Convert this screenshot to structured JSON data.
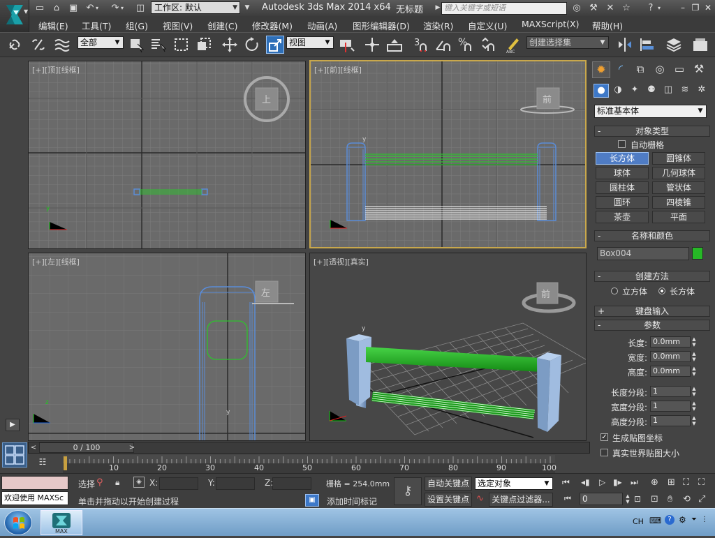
{
  "titlebar": {
    "workspace_label": "工作区: 默认",
    "app_title": "Autodesk 3ds Max  2014 x64",
    "file_title": "无标题",
    "search_placeholder": "键入关键字或短语"
  },
  "menubar": {
    "items": [
      "编辑(E)",
      "工具(T)",
      "组(G)",
      "视图(V)",
      "创建(C)",
      "修改器(M)",
      "动画(A)",
      "图形编辑器(D)",
      "渲染(R)",
      "自定义(U)",
      "MAXScript(X)",
      "帮助(H)"
    ]
  },
  "toolbar": {
    "selection_filter": "全部",
    "reference_coord": "视图",
    "named_selection_placeholder": "创建选择集"
  },
  "viewports": {
    "top": {
      "label": "[+][顶][线框]",
      "cube_label": "上"
    },
    "front": {
      "label": "[+][前][线框]",
      "cube_label": "前"
    },
    "left": {
      "label": "[+][左][线框]",
      "cube_label": "左"
    },
    "perspective": {
      "label": "[+][透视][真实]",
      "cube_label": "前"
    }
  },
  "command_panel": {
    "category": "标准基本体",
    "object_type": {
      "title": "对象类型",
      "autogrid": "自动栅格",
      "buttons": [
        "长方体",
        "圆锥体",
        "球体",
        "几何球体",
        "圆柱体",
        "管状体",
        "圆环",
        "四棱锥",
        "茶壶",
        "平面"
      ],
      "active": "长方体"
    },
    "name_color": {
      "title": "名称和颜色",
      "name": "Box004",
      "color": "#26b826"
    },
    "creation_method": {
      "title": "创建方法",
      "option_cube": "立方体",
      "option_box": "长方体",
      "selected": "长方体"
    },
    "keyboard_entry": {
      "title": "键盘输入"
    },
    "parameters": {
      "title": "参数",
      "length_label": "长度:",
      "length": "0.0mm",
      "width_label": "宽度:",
      "width": "0.0mm",
      "height_label": "高度:",
      "height": "0.0mm",
      "length_segs_label": "长度分段:",
      "length_segs": "1",
      "width_segs_label": "宽度分段:",
      "width_segs": "1",
      "height_segs_label": "高度分段:",
      "height_segs": "1",
      "gen_mapping": "生成贴图坐标",
      "gen_mapping_checked": true,
      "real_world": "真实世界贴图大小",
      "real_world_checked": false
    }
  },
  "timeline": {
    "frame_display": "0 / 100",
    "ticks": [
      "10",
      "20",
      "30",
      "40",
      "50",
      "60",
      "70",
      "80",
      "90",
      "100"
    ]
  },
  "status": {
    "welcome": "欢迎使用 MAXSc",
    "selection": "选择",
    "x_label": "X:",
    "y_label": "Y:",
    "z_label": "Z:",
    "grid": "栅格 = 254.0mm",
    "prompt": "单击并拖动以开始创建过程",
    "add_time_tag": "添加时间标记",
    "auto_key": "自动关键点",
    "set_key": "设置关键点",
    "key_mode": "选定对象",
    "key_filters": "关键点过滤器...",
    "current_frame": "0"
  },
  "taskbar": {
    "max_label": "MAX",
    "language": "CH"
  }
}
